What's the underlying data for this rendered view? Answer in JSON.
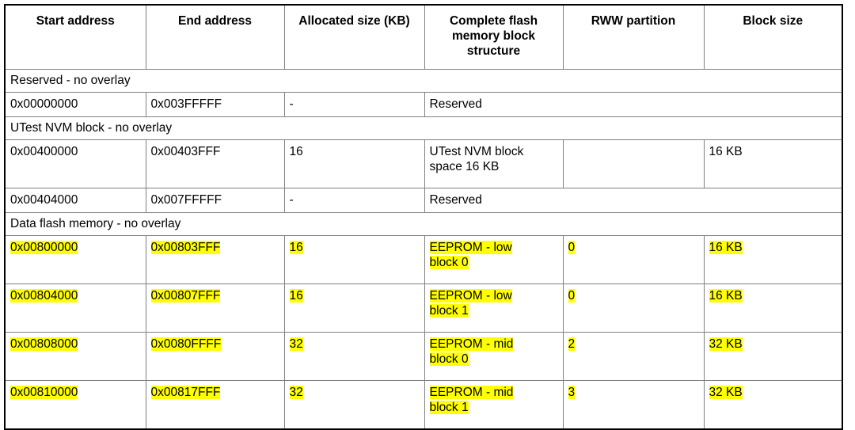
{
  "table": {
    "name": "flash-memory-map",
    "highlight_color": "#FFFF00",
    "columns": [
      {
        "key": "start_address",
        "label": "Start address"
      },
      {
        "key": "end_address",
        "label": "End address"
      },
      {
        "key": "allocated_size",
        "label": "Allocated size\n(KB)"
      },
      {
        "key": "block_structure",
        "label": "Complete flash\nmemory block\nstructure"
      },
      {
        "key": "rww_partition",
        "label": "RWW partition"
      },
      {
        "key": "block_size",
        "label": "Block size"
      }
    ],
    "rows": [
      {
        "type": "section",
        "label": "Reserved - no overlay"
      },
      {
        "type": "data",
        "start_address": "0x00000000",
        "end_address": "0x003FFFFF",
        "allocated_size": "-",
        "block_structure": "Reserved",
        "block_structure_colspan": 3,
        "highlighted": false
      },
      {
        "type": "section",
        "label": "UTest NVM block - no overlay"
      },
      {
        "type": "data",
        "tall": true,
        "start_address": "0x00400000",
        "end_address": "0x00403FFF",
        "allocated_size": "16",
        "block_structure": "UTest NVM block\nspace 16 KB",
        "rww_partition": "",
        "block_size": "16 KB",
        "highlighted": false
      },
      {
        "type": "data",
        "start_address": "0x00404000",
        "end_address": "0x007FFFFF",
        "allocated_size": "-",
        "block_structure": "Reserved",
        "block_structure_colspan": 3,
        "highlighted": false
      },
      {
        "type": "section",
        "label": "Data flash memory - no overlay"
      },
      {
        "type": "data",
        "tall": true,
        "start_address": "0x00800000",
        "end_address": "0x00803FFF",
        "allocated_size": "16",
        "block_structure": "EEPROM - low\nblock 0",
        "rww_partition": "0",
        "block_size": "16 KB",
        "highlighted": true
      },
      {
        "type": "data",
        "tall": true,
        "start_address": "0x00804000",
        "end_address": "0x00807FFF",
        "allocated_size": "16",
        "block_structure": "EEPROM - low\nblock 1",
        "rww_partition": "0",
        "block_size": "16 KB",
        "highlighted": true
      },
      {
        "type": "data",
        "tall": true,
        "start_address": "0x00808000",
        "end_address": "0x0080FFFF",
        "allocated_size": "32",
        "block_structure": "EEPROM - mid\nblock 0",
        "rww_partition": "2",
        "block_size": "32 KB",
        "highlighted": true
      },
      {
        "type": "data",
        "tall": true,
        "start_address": "0x00810000",
        "end_address": "0x00817FFF",
        "allocated_size": "32",
        "block_structure": "EEPROM - mid\nblock 1",
        "rww_partition": "3",
        "block_size": "32 KB",
        "highlighted": true
      }
    ]
  }
}
